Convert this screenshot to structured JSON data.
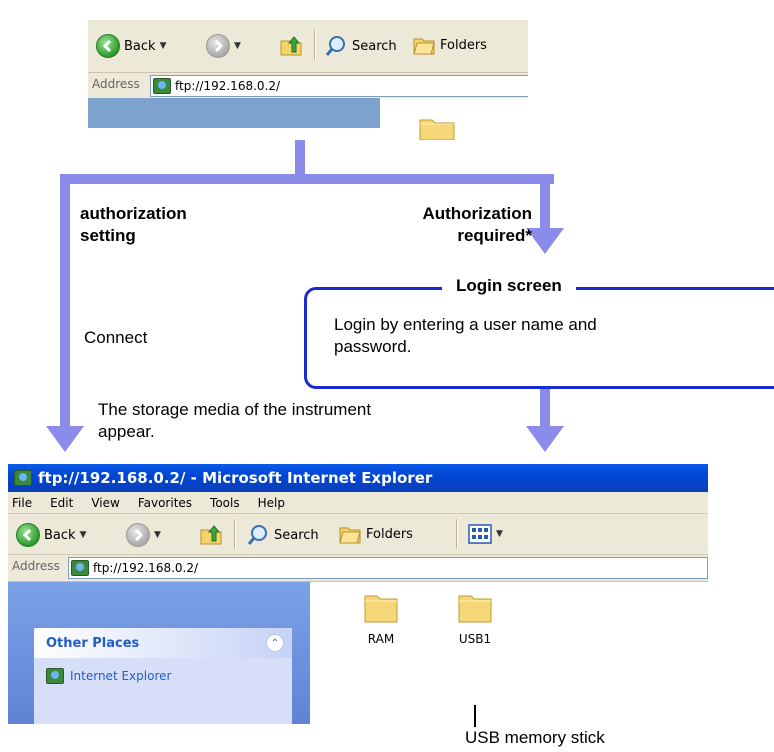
{
  "top_window": {
    "toolbar": {
      "back_label": "Back",
      "search_label": "Search",
      "folders_label": "Folders"
    },
    "address_label": "Address",
    "address_value": "ftp://192.168.0.2/"
  },
  "diagram": {
    "no_auth_label": "authorization\nsetting",
    "auth_label": "Authorization\nrequired*",
    "connect_label": "Connect",
    "login_title": "Login screen",
    "login_text": "Login by entering a user name and\npassword.",
    "result_text": "The storage media of the instrument\nappear.",
    "usb_caption": "USB memory stick"
  },
  "bottom_window": {
    "title": "ftp://192.168.0.2/ - Microsoft Internet Explorer",
    "menu": [
      "File",
      "Edit",
      "View",
      "Favorites",
      "Tools",
      "Help"
    ],
    "toolbar": {
      "back_label": "Back",
      "search_label": "Search",
      "folders_label": "Folders"
    },
    "address_label": "Address",
    "address_value": "ftp://192.168.0.2/",
    "other_places_title": "Other Places",
    "other_places_link": "Internet Explorer",
    "items": [
      {
        "name": "RAM"
      },
      {
        "name": "USB1"
      }
    ]
  },
  "colors": {
    "flow": "#8b8be9",
    "login_border": "#1c2bd0",
    "xp_title": "#0a3fb8"
  }
}
